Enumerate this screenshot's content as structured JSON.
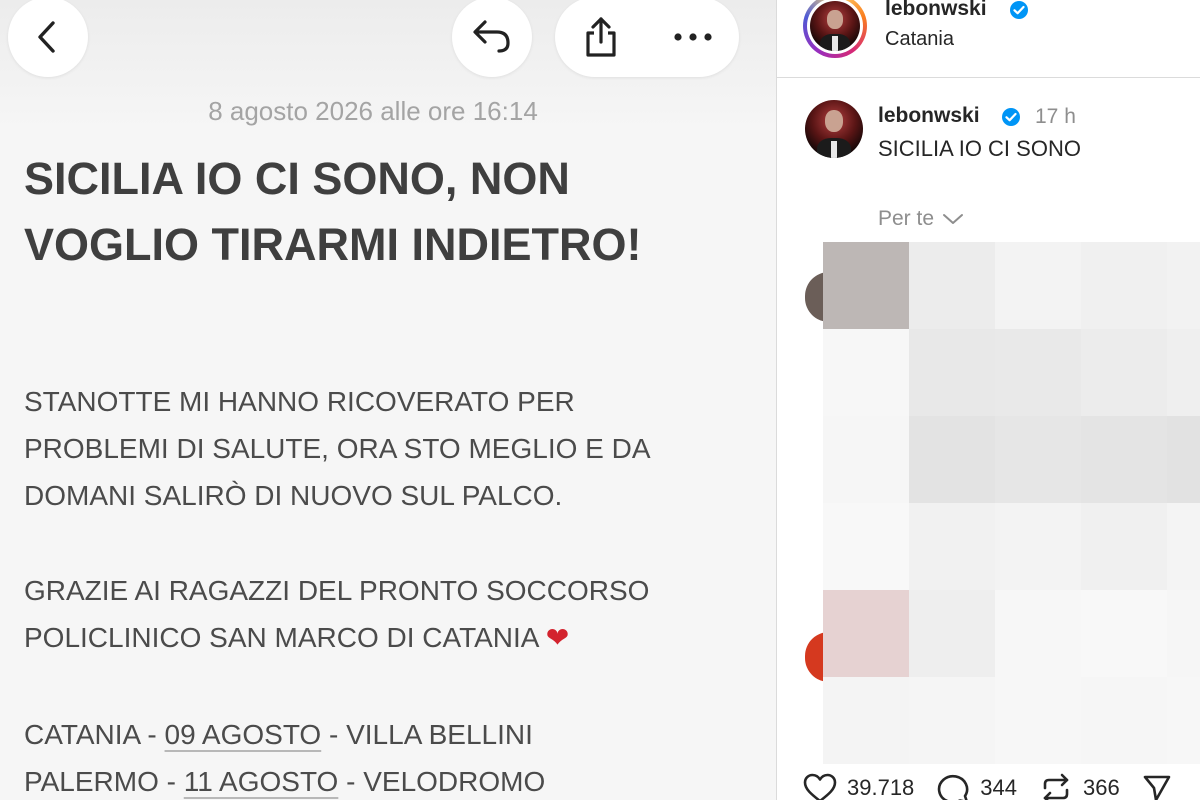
{
  "note": {
    "date": "8 agosto 2026 alle ore 16:14",
    "title_line1": "SICILIA IO CI SONO, NON",
    "title_line2": "VOGLIO TIRARMI INDIETRO!",
    "para1_line1": "STANOTTE MI HANNO RICOVERATO PER",
    "para1_line2": "PROBLEMI DI SALUTE, ORA STO MEGLIO E DA",
    "para1_line3": "DOMANI SALIRÒ DI NUOVO SUL PALCO.",
    "para2_line1": "GRAZIE AI RAGAZZI DEL PRONTO SOCCORSO",
    "para2_line2": "POLICLINICO SAN MARCO DI CATANIA",
    "heart_emoji": "❤",
    "dates": [
      {
        "city": "CATANIA - ",
        "date": "09 AGOSTO",
        "venue": " - VILLA BELLINI"
      },
      {
        "city": "PALERMO - ",
        "date": "11 AGOSTO",
        "venue": " - VELODROMO"
      }
    ]
  },
  "toolbar": {
    "icons": [
      "back-chevron-icon",
      "reply-arrow-icon",
      "share-icon",
      "more-icon"
    ]
  },
  "instagram": {
    "header_username": "lebonwski",
    "header_location": "Catania",
    "post_username": "lebonwski",
    "post_time": "17 h",
    "caption": "SICILIA IO CI SONO",
    "comments_filter": "Per te",
    "likes": "39.718",
    "comments": "344",
    "reposts": "366",
    "accent_verified": "#0095f6"
  }
}
